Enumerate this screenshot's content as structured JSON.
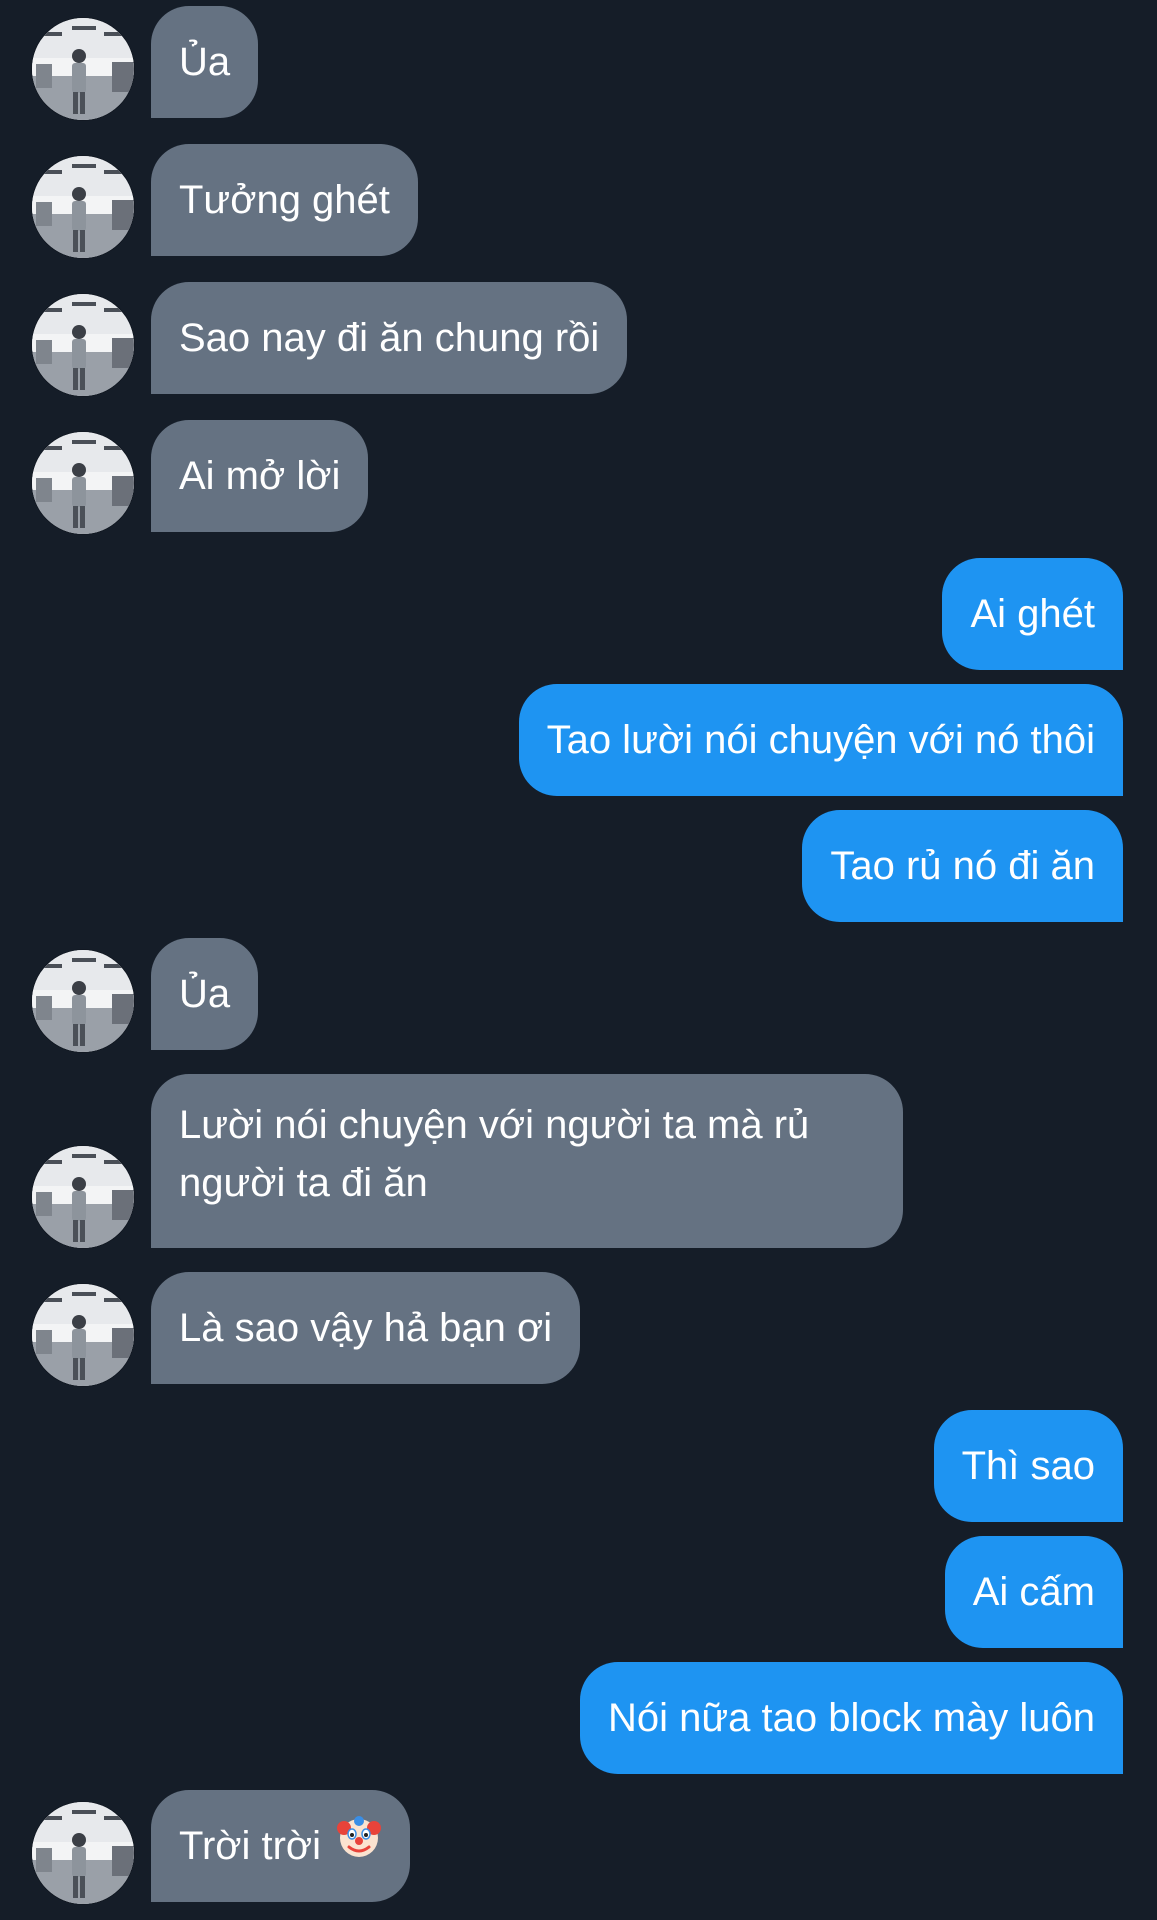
{
  "colors": {
    "background": "#151d28",
    "incoming_bubble": "#657282",
    "outgoing_bubble": "#1e94f2",
    "text": "#ffffff"
  },
  "messages": [
    {
      "direction": "in",
      "text": "Ủa"
    },
    {
      "direction": "in",
      "text": "Tưởng ghét"
    },
    {
      "direction": "in",
      "text": "Sao nay đi ăn chung rồi"
    },
    {
      "direction": "in",
      "text": "Ai mở lời"
    },
    {
      "direction": "out",
      "text": "Ai ghét"
    },
    {
      "direction": "out",
      "text": "Tao lười nói chuyện với nó thôi"
    },
    {
      "direction": "out",
      "text": "Tao rủ nó đi ăn"
    },
    {
      "direction": "in",
      "text": "Ủa"
    },
    {
      "direction": "in",
      "text": "Lười nói chuyện với người ta mà rủ người ta đi ăn"
    },
    {
      "direction": "in",
      "text": "Là sao vậy hả bạn ơi"
    },
    {
      "direction": "out",
      "text": "Thì sao"
    },
    {
      "direction": "out",
      "text": "Ai cấm"
    },
    {
      "direction": "out",
      "text": "Nói nữa tao block mày luôn"
    },
    {
      "direction": "in",
      "text": "Trời trời",
      "emoji": "clown-face-icon"
    }
  ]
}
